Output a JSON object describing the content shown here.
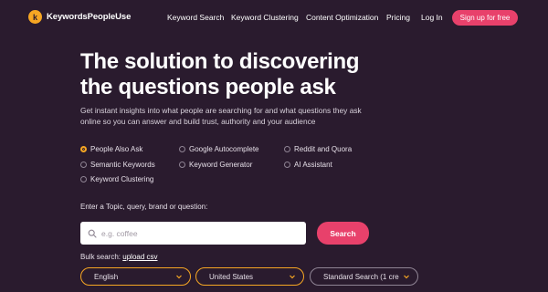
{
  "brand": {
    "name": "KeywordsPeopleUse",
    "logo_letter": "k",
    "logo_color": "#f6a623"
  },
  "nav": {
    "links": [
      "Keyword Search",
      "Keyword Clustering",
      "Content Optimization",
      "Pricing",
      "Log In"
    ],
    "cta": "Sign up for free"
  },
  "hero": {
    "title_line1": "The solution to discovering",
    "title_line2": "the questions people ask",
    "subtitle": "Get instant insights into what people are searching for and what questions they ask online so you can answer and build trust, authority and your audience"
  },
  "options": [
    {
      "label": "People Also Ask",
      "selected": true
    },
    {
      "label": "Google Autocomplete",
      "selected": false
    },
    {
      "label": "Reddit and Quora",
      "selected": false
    },
    {
      "label": "Semantic Keywords",
      "selected": false
    },
    {
      "label": "Keyword Generator",
      "selected": false
    },
    {
      "label": "AI Assistant",
      "selected": false
    },
    {
      "label": "Keyword Clustering",
      "selected": false
    }
  ],
  "search": {
    "label": "Enter a Topic, query, brand or question:",
    "placeholder": "e.g. coffee",
    "button": "Search"
  },
  "bulk": {
    "prefix": "Bulk search:",
    "link": "upload csv"
  },
  "selects": {
    "language": "English",
    "country": "United States",
    "mode": "Standard Search (1 cre"
  },
  "colors": {
    "background": "#2a1b2e",
    "accent": "#e8416b",
    "highlight": "#f6a623"
  }
}
